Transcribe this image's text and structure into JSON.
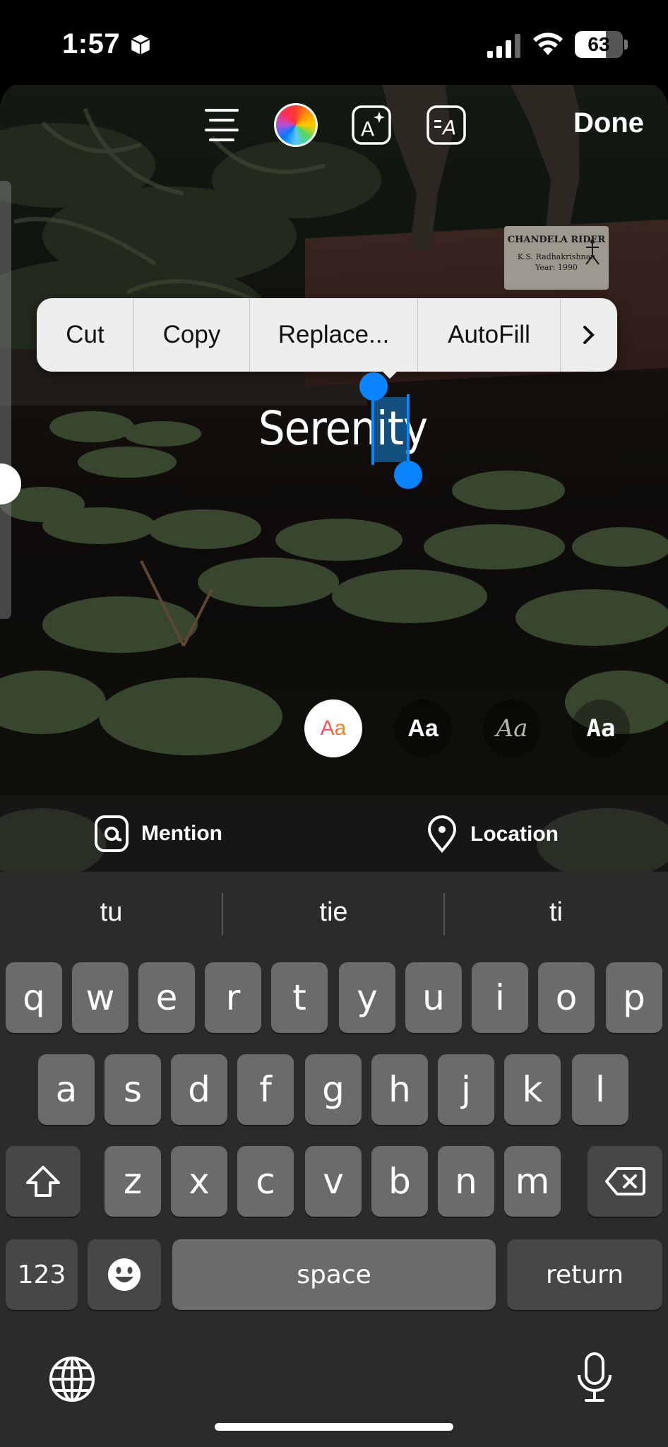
{
  "status_bar": {
    "time": "1:57",
    "battery": "63"
  },
  "toolbar": {
    "done_label": "Done"
  },
  "edit_menu": {
    "cut": "Cut",
    "copy": "Copy",
    "replace": "Replace...",
    "autofill": "AutoFill"
  },
  "story": {
    "text": "Serenity"
  },
  "plaque": {
    "line1": "CHANDELA RIDER",
    "line2": "K.S. Radhakrishnan",
    "line3": "Year: 1990"
  },
  "font_styles": {
    "classic": "Aa",
    "modern": "Aa",
    "script": "Aa",
    "typewriter": "Aa"
  },
  "stickers": {
    "mention": "Mention",
    "location": "Location"
  },
  "keyboard": {
    "predictions": [
      "tu",
      "tie",
      "ti"
    ],
    "row1": [
      "q",
      "w",
      "e",
      "r",
      "t",
      "y",
      "u",
      "i",
      "o",
      "p"
    ],
    "row2": [
      "a",
      "s",
      "d",
      "f",
      "g",
      "h",
      "j",
      "k",
      "l"
    ],
    "row3": [
      "z",
      "x",
      "c",
      "v",
      "b",
      "n",
      "m"
    ],
    "numbers_label": "123",
    "space_label": "space",
    "return_label": "return"
  },
  "icons": [
    "package-icon",
    "signal-icon",
    "wifi-icon",
    "align-icon",
    "color-wheel-icon",
    "text-effects-icon",
    "text-animation-icon",
    "chevron-right-icon",
    "at-icon",
    "location-pin-icon",
    "shift-icon",
    "backspace-icon",
    "emoji-icon",
    "globe-icon",
    "microphone-icon"
  ]
}
